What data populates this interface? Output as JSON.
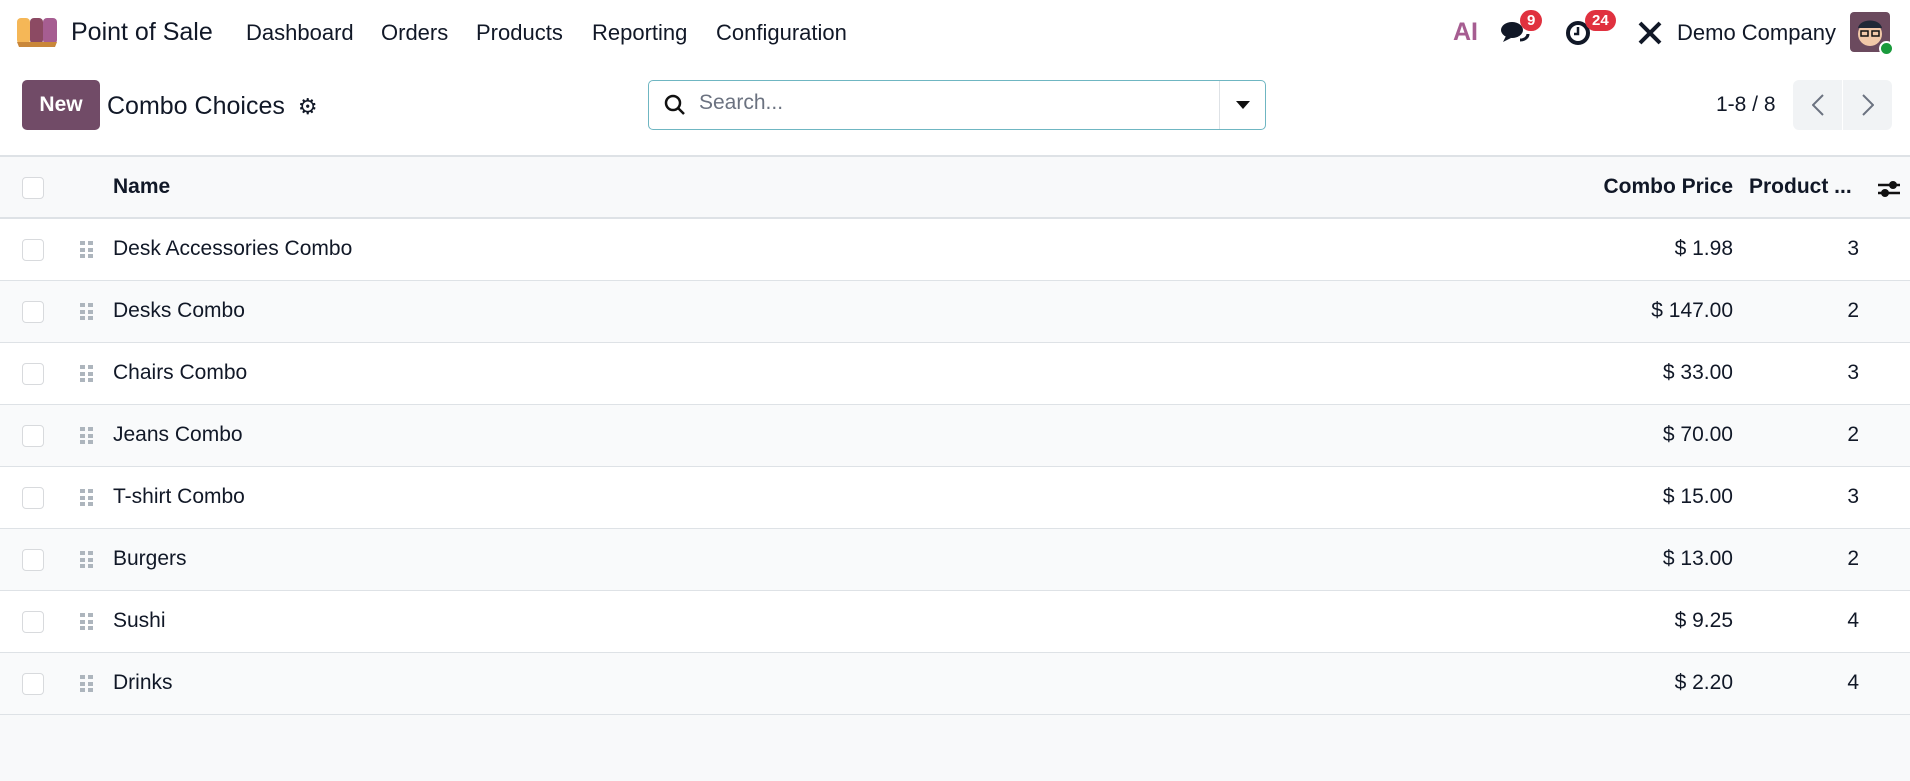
{
  "navbar": {
    "app_name": "Point of Sale",
    "menu": [
      "Dashboard",
      "Orders",
      "Products",
      "Reporting",
      "Configuration"
    ],
    "ai_label": "AI",
    "messages_count": "9",
    "activities_count": "24",
    "company": "Demo Company"
  },
  "control_panel": {
    "new_label": "New",
    "title": "Combo Choices",
    "search_placeholder": "Search...",
    "pager": "1-8 / 8"
  },
  "table": {
    "headers": {
      "name": "Name",
      "price": "Combo Price",
      "count": "Product ..."
    },
    "rows": [
      {
        "name": "Desk Accessories Combo",
        "price": "$ 1.98",
        "count": "3"
      },
      {
        "name": "Desks Combo",
        "price": "$ 147.00",
        "count": "2"
      },
      {
        "name": "Chairs Combo",
        "price": "$ 33.00",
        "count": "3"
      },
      {
        "name": "Jeans Combo",
        "price": "$ 70.00",
        "count": "2"
      },
      {
        "name": "T-shirt Combo",
        "price": "$ 15.00",
        "count": "3"
      },
      {
        "name": "Burgers",
        "price": "$ 13.00",
        "count": "2"
      },
      {
        "name": "Sushi",
        "price": "$ 9.25",
        "count": "4"
      },
      {
        "name": "Drinks",
        "price": "$ 2.20",
        "count": "4"
      }
    ]
  },
  "colors": {
    "brand": "#714b67",
    "badge": "#e0313f",
    "online": "#1a9a3c"
  }
}
